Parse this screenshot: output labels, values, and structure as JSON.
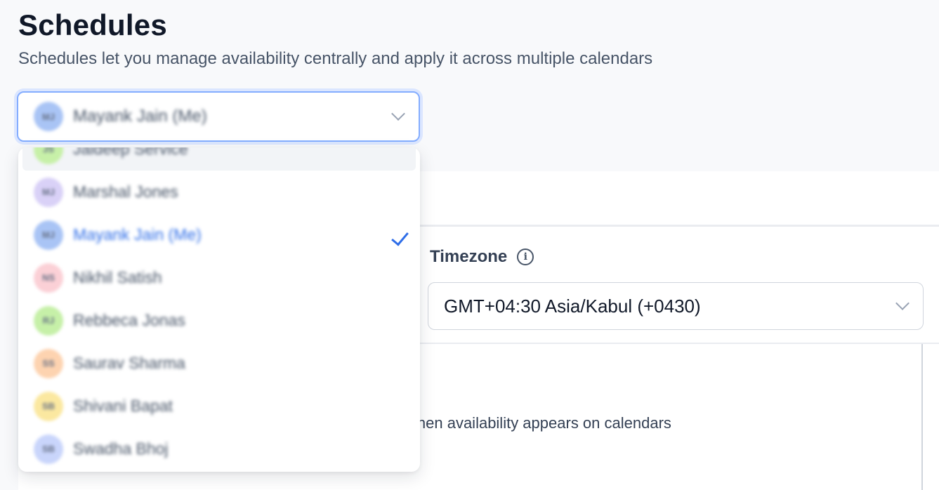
{
  "header": {
    "title": "Schedules",
    "subtitle": "Schedules let you manage availability centrally and apply it across multiple calendars"
  },
  "member_select": {
    "selected_name": "Mayank Jain (Me)",
    "selected_initials": "MJ",
    "selected_color": "#a9c4f5",
    "icon": "chevron-down-icon"
  },
  "dropdown": {
    "options": [
      {
        "name": "Jaideep Service",
        "initials": "JS",
        "color": "#c7f0a8",
        "hover": true
      },
      {
        "name": "Marshal Jones",
        "initials": "MJ",
        "color": "#d9d1f7"
      },
      {
        "name": "Mayank Jain (Me)",
        "initials": "MJ",
        "color": "#a9c4f5",
        "selected": true
      },
      {
        "name": "Nikhil Satish",
        "initials": "NS",
        "color": "#fbd0d6"
      },
      {
        "name": "Rebbeca Jonas",
        "initials": "RJ",
        "color": "#c6f0a8"
      },
      {
        "name": "Saurav Sharma",
        "initials": "SS",
        "color": "#fdd3b0"
      },
      {
        "name": "Shivani Bapat",
        "initials": "SB",
        "color": "#fbe8a0"
      },
      {
        "name": "Swadha Bhoj",
        "initials": "SB",
        "color": "#c9d5fb"
      }
    ],
    "check_icon": "check-icon",
    "check_color": "#2f6ee8"
  },
  "timezone": {
    "label": "Timezone",
    "info_icon": "info-icon",
    "value": "GMT+04:30 Asia/Kabul (+0430)"
  },
  "description": {
    "partial_text": "when availability appears on calendars"
  }
}
